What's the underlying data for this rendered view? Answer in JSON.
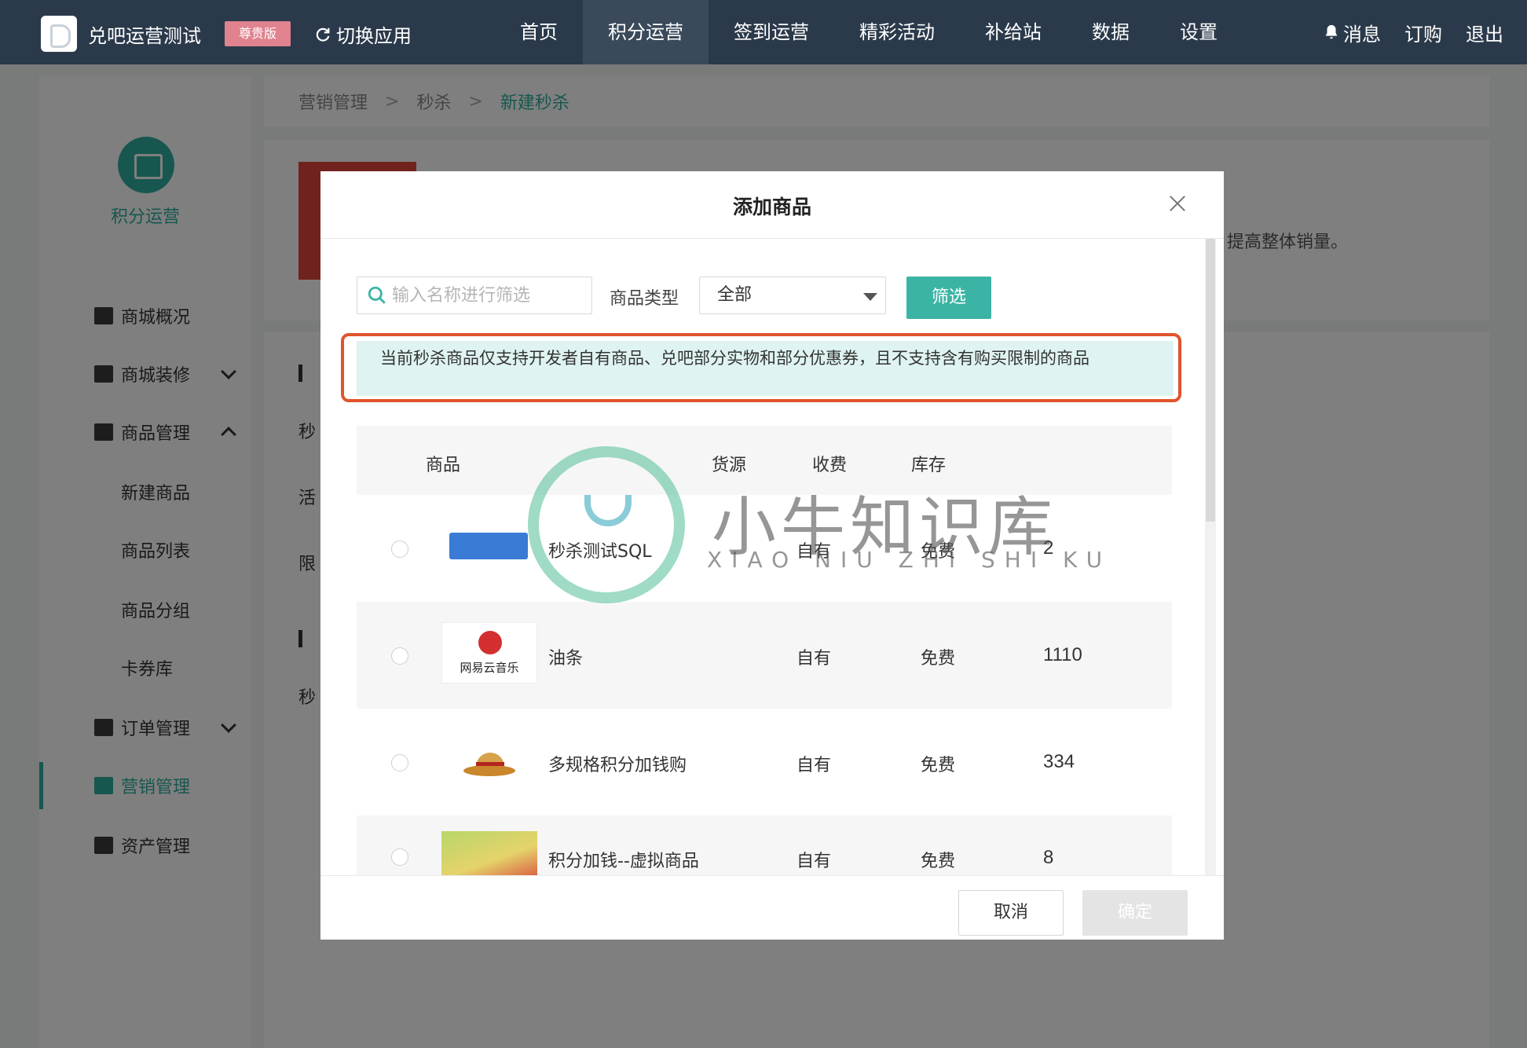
{
  "topnav": {
    "app_title": "兑吧运营测试",
    "badge": "尊贵版",
    "switch_label": "切换应用",
    "menu": [
      "首页",
      "积分运营",
      "签到运营",
      "精彩活动",
      "补给站",
      "数据",
      "设置"
    ],
    "active_menu": "积分运营",
    "messages": "消息",
    "order": "订购",
    "logout": "退出"
  },
  "sidebar": {
    "brand": "积分运营",
    "items": [
      {
        "label": "商城概况",
        "icon": "chart-icon"
      },
      {
        "label": "商城装修",
        "icon": "paint-icon",
        "expand": "down"
      },
      {
        "label": "商品管理",
        "icon": "box-icon",
        "expand": "up"
      },
      {
        "label": "新建商品"
      },
      {
        "label": "商品列表"
      },
      {
        "label": "商品分组"
      },
      {
        "label": "卡券库"
      },
      {
        "label": "订单管理",
        "icon": "clipboard-icon",
        "expand": "down"
      },
      {
        "label": "营销管理",
        "icon": "briefcase-icon",
        "active": true
      },
      {
        "label": "资产管理",
        "icon": "wallet-icon"
      }
    ]
  },
  "breadcrumb": [
    "营销管理",
    "秒杀",
    "新建秒杀"
  ],
  "main": {
    "desc_tail": "提高整体销量。",
    "peek_labels": [
      "秒",
      "活",
      "限",
      "秒"
    ]
  },
  "modal": {
    "title": "添加商品",
    "search_placeholder": "输入名称进行筛选",
    "type_label": "商品类型",
    "type_value": "全部",
    "filter_button": "筛选",
    "notice": "当前秒杀商品仅支持开发者自有商品、兑吧部分实物和部分优惠券，且不支持含有购买限制的商品",
    "columns": [
      "商品",
      "货源",
      "收费",
      "库存"
    ],
    "rows": [
      {
        "name": "秒杀测试SQL",
        "source": "自有",
        "fee": "免费",
        "stock": "2"
      },
      {
        "name": "油条",
        "source": "自有",
        "fee": "免费",
        "stock": "1110"
      },
      {
        "name": "多规格积分加钱购",
        "source": "自有",
        "fee": "免费",
        "stock": "334"
      },
      {
        "name": "积分加钱--虚拟商品",
        "source": "自有",
        "fee": "免费",
        "stock": "8"
      }
    ],
    "music_logo_text": "网易云音乐",
    "cancel": "取消",
    "confirm": "确定"
  },
  "watermark": {
    "text": "小牛知识库",
    "sub": "XIAO NIU ZHI SHI KU"
  }
}
